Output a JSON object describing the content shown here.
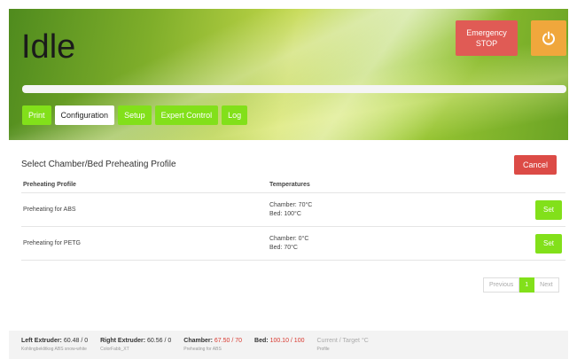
{
  "header": {
    "status": "Idle",
    "estop_label_line1": "Emergency",
    "estop_label_line2": "STOP",
    "power_icon": "power-icon",
    "progress": 0,
    "tabs": [
      {
        "label": "Print",
        "active": false
      },
      {
        "label": "Configuration",
        "active": true
      },
      {
        "label": "Setup",
        "active": false
      },
      {
        "label": "Expert Control",
        "active": false
      },
      {
        "label": "Log",
        "active": false
      }
    ]
  },
  "main": {
    "title": "Select Chamber/Bed Preheating Profile",
    "cancel_label": "Cancel",
    "columns": [
      "Preheating Profile",
      "Temperatures"
    ],
    "rows": [
      {
        "profile": "Preheating for ABS",
        "chamber": "Chamber: 70°C",
        "bed": "Bed: 100°C",
        "action": "Set"
      },
      {
        "profile": "Preheating for PETG",
        "chamber": "Chamber: 0°C",
        "bed": "Bed: 70°C",
        "action": "Set"
      }
    ],
    "pagination": {
      "previous": "Previous",
      "current": "1",
      "next": "Next"
    }
  },
  "footer": {
    "left_extruder": {
      "label": "Left Extruder:",
      "value": "60.48 / 0",
      "sub": "Kohlingbeklitkog ABS snow-white"
    },
    "right_extruder": {
      "label": "Right Extruder:",
      "value": "60.56 / 0",
      "sub": "ColorFabb_XT"
    },
    "chamber": {
      "label": "Chamber:",
      "value": "67.50 / 70",
      "sub": "Preheating for ABS"
    },
    "bed": {
      "label": "Bed:",
      "value": "100.10 / 100",
      "sub": ""
    },
    "legend": {
      "label": "Current / Target °C",
      "sub": "Profile"
    }
  },
  "colors": {
    "accent": "#82e01a",
    "danger": "#dc4b46",
    "power": "#f0a73c"
  }
}
